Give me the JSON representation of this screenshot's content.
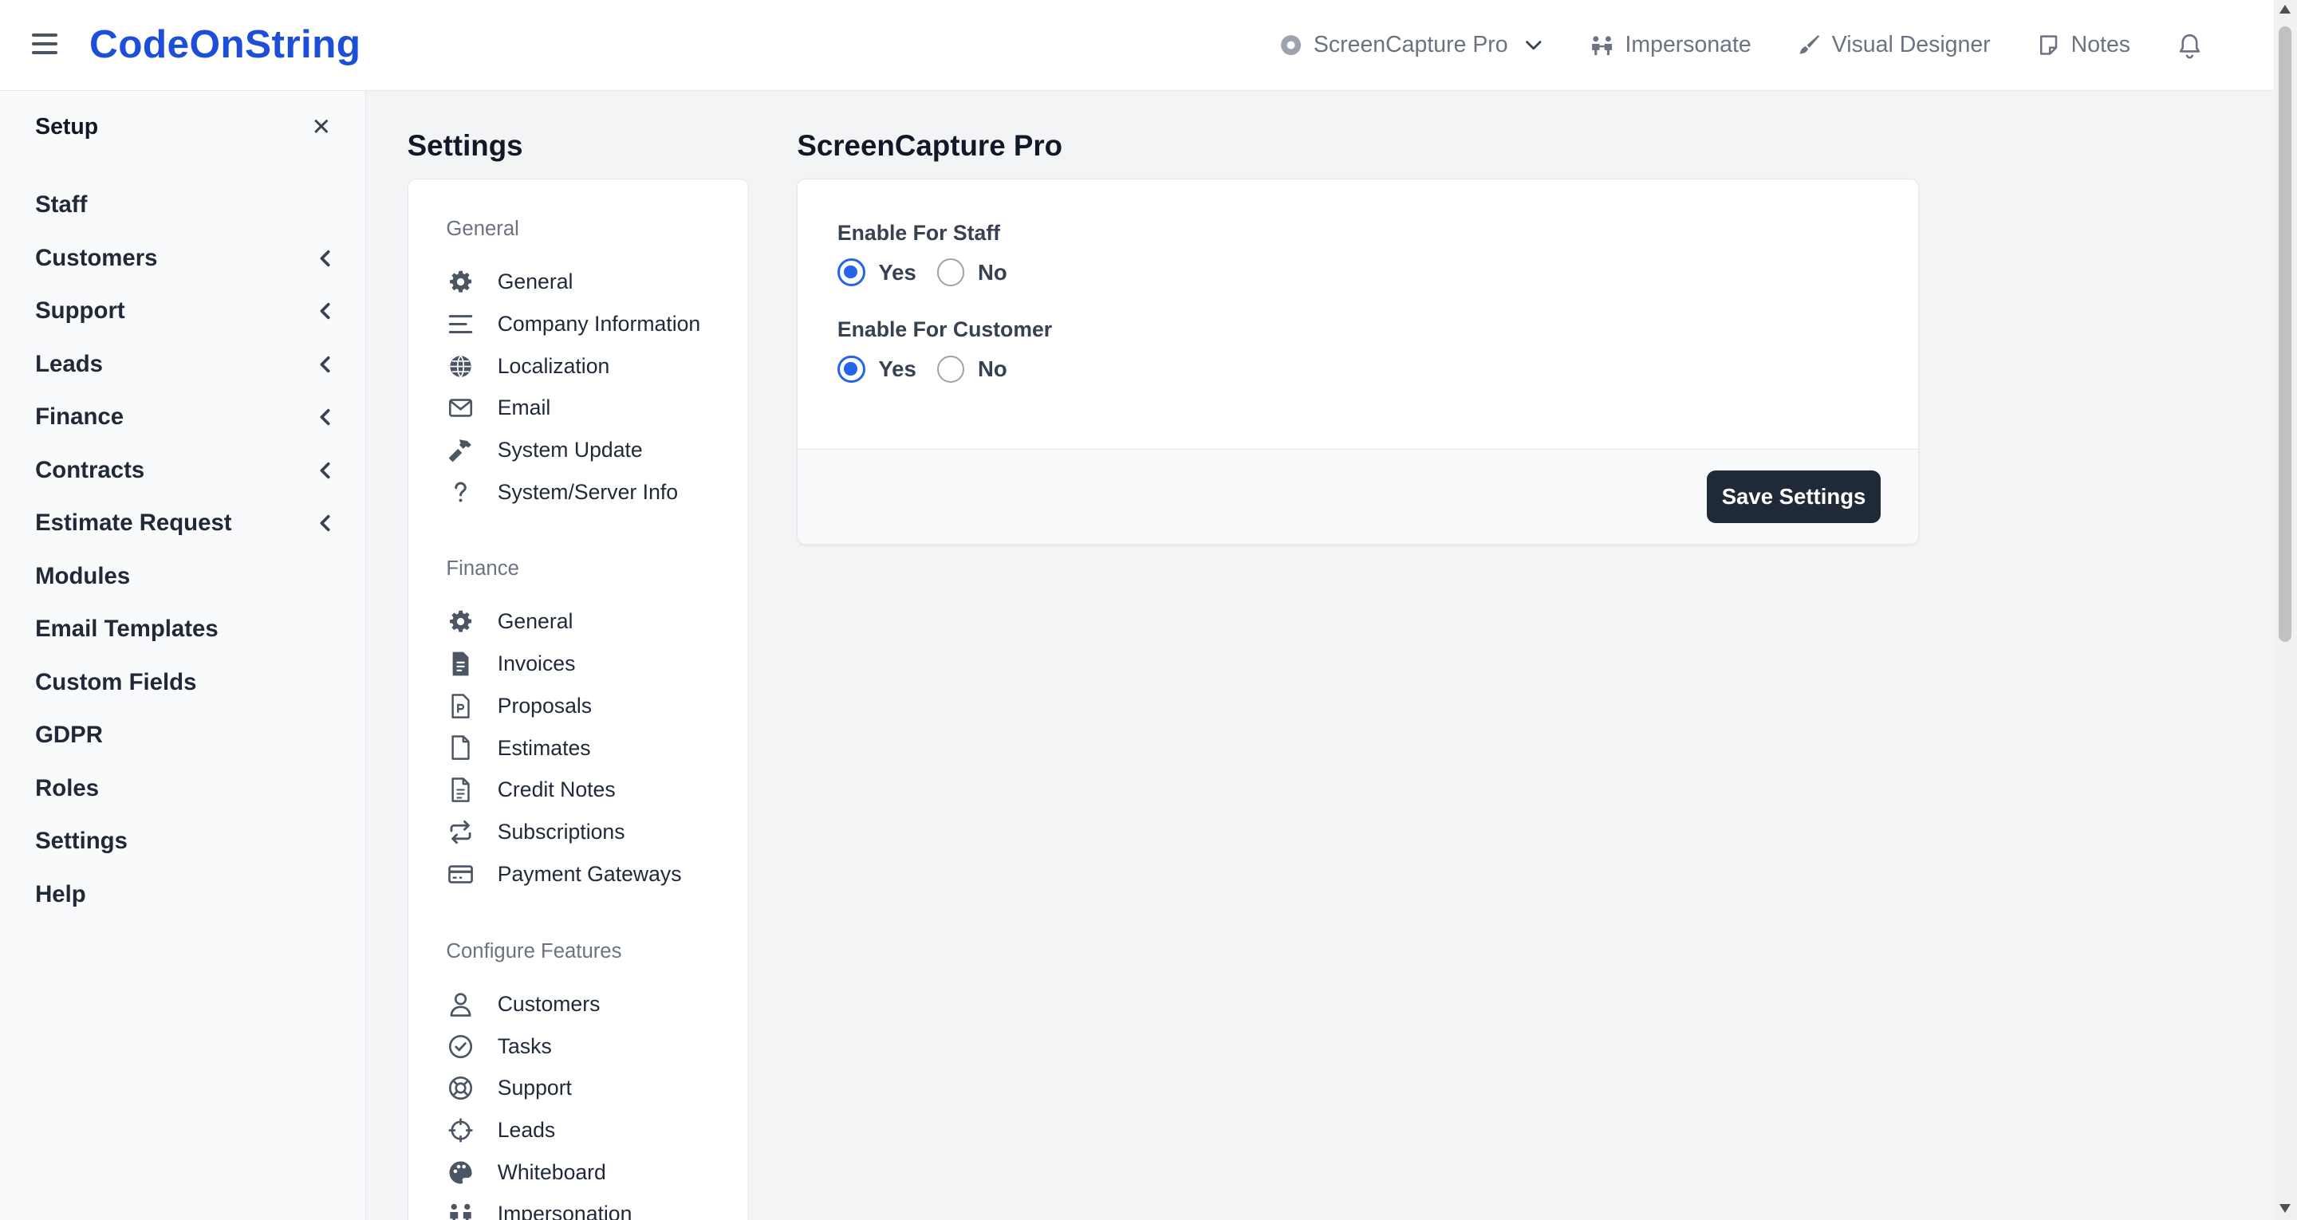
{
  "brand": "CodeOnString",
  "topnav": {
    "module_select": "ScreenCapture Pro",
    "impersonate": "Impersonate",
    "visual_designer": "Visual Designer",
    "notes": "Notes"
  },
  "sidebar": {
    "title": "Setup",
    "close": "✕",
    "items": [
      {
        "label": "Staff",
        "has_children": false
      },
      {
        "label": "Customers",
        "has_children": true
      },
      {
        "label": "Support",
        "has_children": true
      },
      {
        "label": "Leads",
        "has_children": true
      },
      {
        "label": "Finance",
        "has_children": true
      },
      {
        "label": "Contracts",
        "has_children": true
      },
      {
        "label": "Estimate Request",
        "has_children": true
      },
      {
        "label": "Modules",
        "has_children": false
      },
      {
        "label": "Email Templates",
        "has_children": false
      },
      {
        "label": "Custom Fields",
        "has_children": false
      },
      {
        "label": "GDPR",
        "has_children": false
      },
      {
        "label": "Roles",
        "has_children": false
      },
      {
        "label": "Settings",
        "has_children": false
      },
      {
        "label": "Help",
        "has_children": false
      }
    ]
  },
  "settings_nav": {
    "title": "Settings",
    "groups": [
      {
        "title": "General",
        "items": [
          {
            "label": "General",
            "icon": "gear-icon"
          },
          {
            "label": "Company Information",
            "icon": "lines-icon"
          },
          {
            "label": "Localization",
            "icon": "globe-icon"
          },
          {
            "label": "Email",
            "icon": "envelope-icon"
          },
          {
            "label": "System Update",
            "icon": "hammer-icon"
          },
          {
            "label": "System/Server Info",
            "icon": "question-icon"
          }
        ]
      },
      {
        "title": "Finance",
        "items": [
          {
            "label": "General",
            "icon": "gear-icon"
          },
          {
            "label": "Invoices",
            "icon": "invoice-icon"
          },
          {
            "label": "Proposals",
            "icon": "proposal-icon"
          },
          {
            "label": "Estimates",
            "icon": "file-icon"
          },
          {
            "label": "Credit Notes",
            "icon": "file-text-icon"
          },
          {
            "label": "Subscriptions",
            "icon": "repeat-icon"
          },
          {
            "label": "Payment Gateways",
            "icon": "credit-card-icon"
          }
        ]
      },
      {
        "title": "Configure Features",
        "items": [
          {
            "label": "Customers",
            "icon": "user-icon"
          },
          {
            "label": "Tasks",
            "icon": "check-circle-icon"
          },
          {
            "label": "Support",
            "icon": "lifebuoy-icon"
          },
          {
            "label": "Leads",
            "icon": "crosshair-icon"
          },
          {
            "label": "Whiteboard",
            "icon": "palette-icon"
          },
          {
            "label": "Impersonation",
            "icon": "people-icon"
          }
        ]
      }
    ]
  },
  "panel": {
    "title": "ScreenCapture Pro",
    "fields": [
      {
        "label": "Enable For Staff",
        "options": [
          "Yes",
          "No"
        ],
        "selected": "Yes"
      },
      {
        "label": "Enable For Customer",
        "options": [
          "Yes",
          "No"
        ],
        "selected": "Yes"
      }
    ],
    "save_label": "Save Settings"
  },
  "colors": {
    "brand": "#1d4ed8",
    "accent": "#2563eb",
    "button": "#1f2937"
  }
}
